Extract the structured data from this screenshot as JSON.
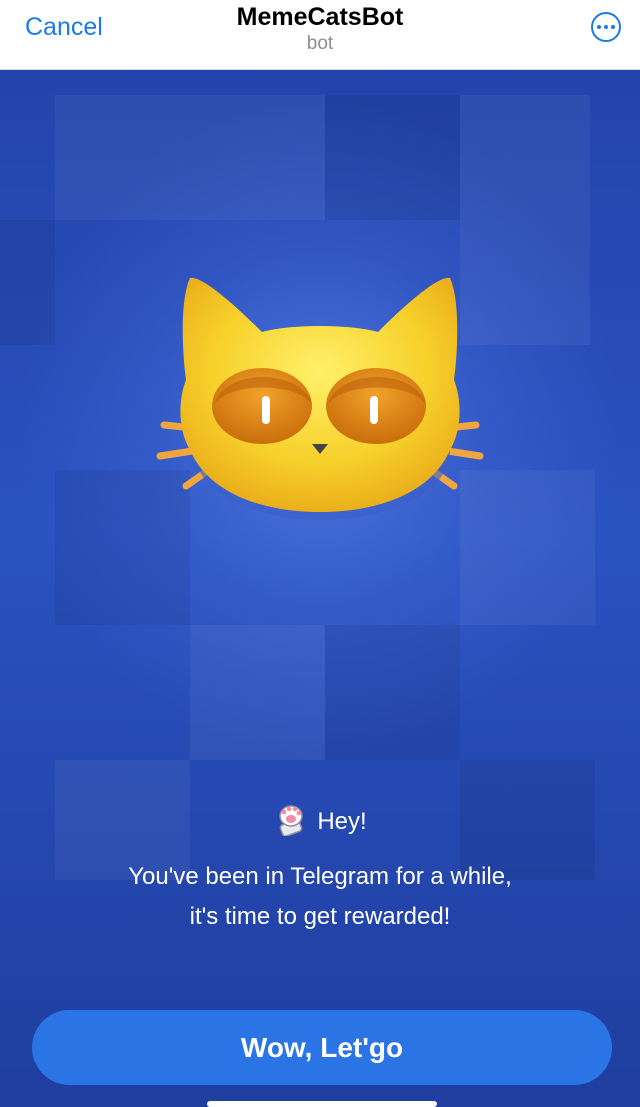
{
  "header": {
    "cancel_label": "Cancel",
    "title": "MemeCatsBot",
    "subtitle": "bot"
  },
  "icons": {
    "more": "ellipsis-circle-icon",
    "mascot": "cat-face-icon",
    "paw": "paw-icon"
  },
  "message": {
    "greeting": "Hey!",
    "line1": "You've been in Telegram for a while,",
    "line2": "it's time to get rewarded!"
  },
  "cta": {
    "label": "Wow, Let'go"
  },
  "colors": {
    "accent": "#1a7be8",
    "background": "#2446ad",
    "button": "#2a74e6",
    "cat": "#f4c91f"
  }
}
